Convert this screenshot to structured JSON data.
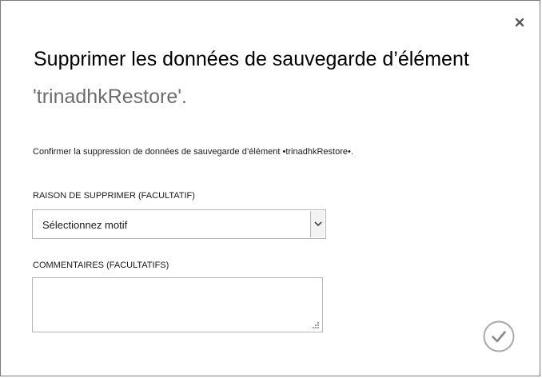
{
  "dialog": {
    "title_line1": "Supprimer les données de sauvegarde d’élément",
    "title_line2": "'trinadhkRestore'.",
    "confirm_message": "Confirmer la suppression de données de sauvegarde d’élément •trinadhkRestore•.",
    "reason": {
      "label": "RAISON DE SUPPRIMER (FACULTATIF)",
      "selected_value": "Sélectionnez motif"
    },
    "comments": {
      "label": "COMMENTAIRES (FACULTATIFS)",
      "value": ""
    },
    "icons": {
      "close": "close-icon",
      "dropdown": "chevron-down-icon",
      "resize": "resize-grip-icon",
      "confirm": "checkmark-icon"
    }
  }
}
